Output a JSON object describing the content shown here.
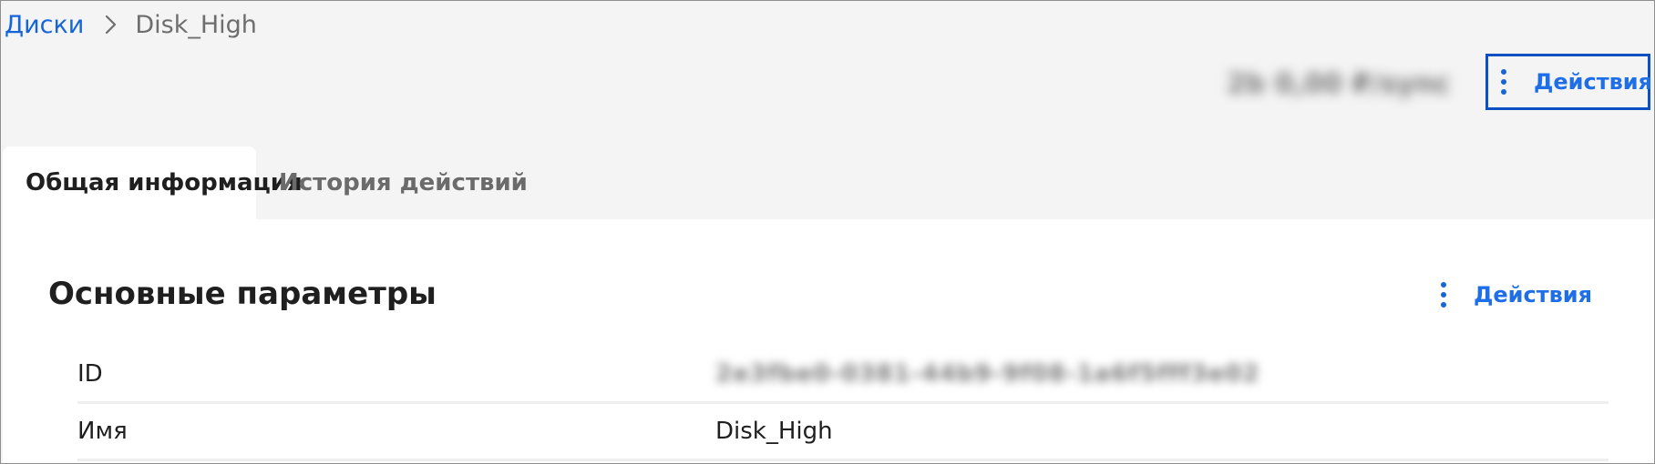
{
  "breadcrumb": {
    "parent_label": "Диски",
    "current_label": "Disk_High",
    "separator_icon": "chevron-right-icon"
  },
  "header": {
    "blurred_info": "2b 0,00 ₽/sync",
    "actions_label": "Действия",
    "actions_icon": "kebab-menu-icon"
  },
  "tabs": [
    {
      "label": "Общая информация",
      "active": true
    },
    {
      "label": "История действий",
      "active": false
    }
  ],
  "section": {
    "title": "Основные параметры",
    "actions_label": "Действия",
    "actions_icon": "kebab-menu-icon"
  },
  "params": [
    {
      "label": "ID",
      "value": "2e3fbe0-0381-44b9-9f08-1a6f5fff3e02",
      "blurred": true
    },
    {
      "label": "Имя",
      "value": "Disk_High",
      "blurred": false
    }
  ],
  "colors": {
    "accent": "#1565d8",
    "focus_border": "#0e4fc2",
    "page_background": "#f4f4f4",
    "panel_background": "#ffffff"
  }
}
